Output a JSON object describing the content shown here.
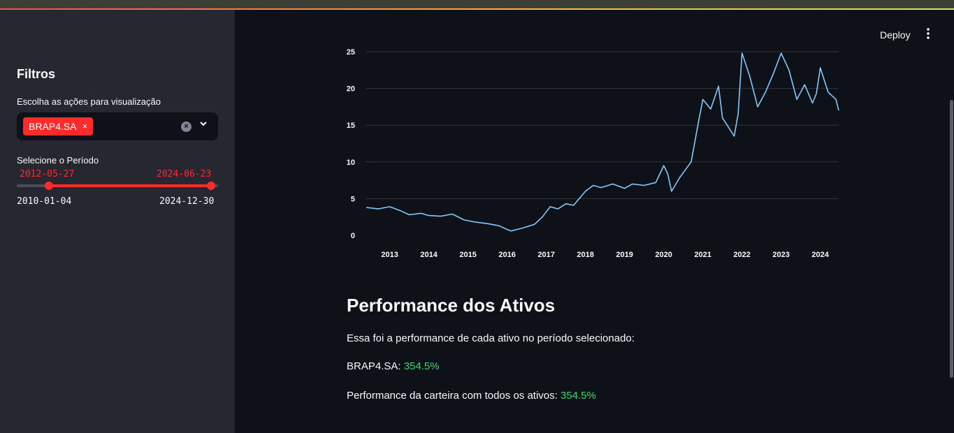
{
  "header": {
    "deploy_label": "Deploy",
    "menu_icon": "kebab-menu-icon"
  },
  "sidebar": {
    "title": "Filtros",
    "stock_select": {
      "label": "Escolha as ações para visualização",
      "selected": [
        "BRAP4.SA"
      ],
      "remove_symbol": "×",
      "clear_symbol": "×"
    },
    "period_slider": {
      "label": "Selecione o Período",
      "value_start": "2012-05-27",
      "value_end": "2024-06-23",
      "min": "2010-01-04",
      "max": "2024-12-30"
    }
  },
  "main": {
    "performance": {
      "title": "Performance dos Ativos",
      "description": "Essa foi a performance de cada ativo no período selecionado:",
      "asset_label": "BRAP4.SA:",
      "asset_value": "354.5%",
      "portfolio_label": "Performance da carteira com todos os ativos:",
      "portfolio_value": "354.5%"
    }
  },
  "colors": {
    "accent": "#ff2b2b",
    "line": "#83c9ff",
    "positive": "#3dd56d",
    "sidebar_bg": "#262730",
    "main_bg": "#0e1117"
  },
  "chart_data": {
    "type": "line",
    "title": "",
    "xlabel": "",
    "ylabel": "",
    "ylim": [
      0,
      25
    ],
    "yticks": [
      0,
      5,
      10,
      15,
      20,
      25
    ],
    "xticks": [
      "2013",
      "2014",
      "2015",
      "2016",
      "2017",
      "2018",
      "2019",
      "2020",
      "2021",
      "2022",
      "2023",
      "2024"
    ],
    "grid": true,
    "series": [
      {
        "x": [
          2012.4,
          2012.7,
          2013.0,
          2013.3,
          2013.5,
          2013.8,
          2014.0,
          2014.3,
          2014.6,
          2014.9,
          2015.2,
          2015.5,
          2015.8,
          2016.0,
          2016.1,
          2016.4,
          2016.7,
          2016.9,
          2017.1,
          2017.3,
          2017.5,
          2017.7,
          2018.0,
          2018.2,
          2018.4,
          2018.7,
          2019.0,
          2019.2,
          2019.5,
          2019.8,
          2020.0,
          2020.1,
          2020.2,
          2020.4,
          2020.7,
          2020.9,
          2021.0,
          2021.2,
          2021.4,
          2021.5,
          2021.8,
          2021.9,
          2022.0,
          2022.2,
          2022.4,
          2022.6,
          2022.8,
          2023.0,
          2023.2,
          2023.4,
          2023.6,
          2023.8,
          2023.9,
          2024.0,
          2024.2,
          2024.4,
          2024.47
        ],
        "y": [
          3.8,
          3.6,
          3.9,
          3.3,
          2.8,
          3.0,
          2.7,
          2.6,
          2.9,
          2.1,
          1.8,
          1.6,
          1.3,
          0.8,
          0.6,
          1.0,
          1.5,
          2.5,
          3.9,
          3.6,
          4.3,
          4.1,
          6.0,
          6.8,
          6.5,
          7.0,
          6.4,
          7.0,
          6.8,
          7.2,
          9.5,
          8.4,
          6.0,
          7.8,
          10.0,
          15.8,
          18.5,
          17.2,
          20.3,
          16.0,
          13.5,
          16.5,
          24.8,
          21.6,
          17.5,
          19.5,
          22.0,
          24.8,
          22.5,
          18.5,
          20.5,
          18.0,
          19.3,
          22.8,
          19.5,
          18.5,
          17.0
        ]
      }
    ]
  }
}
